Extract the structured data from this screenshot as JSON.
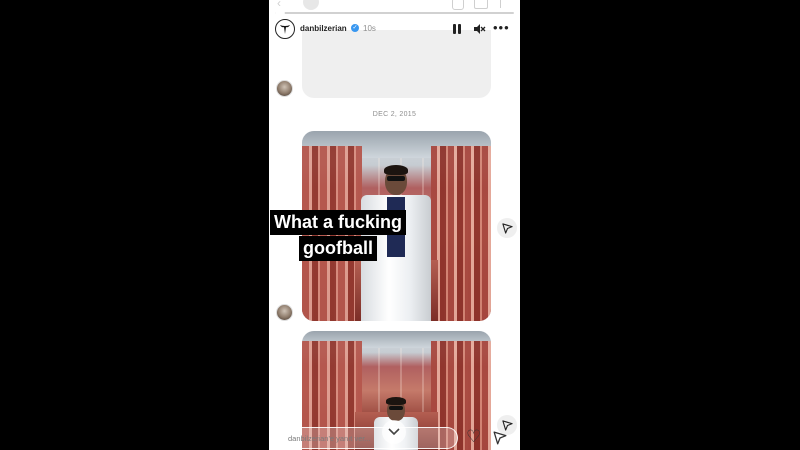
{
  "story": {
    "username": "danbilzerian",
    "time_ago": "10s",
    "progress_fraction": 0.04
  },
  "thread": {
    "date_separator": "DEC 2, 2015"
  },
  "caption": {
    "line1": "What a fucking",
    "line2": "goofball"
  },
  "reply": {
    "placeholder": "danbilzerian'e yanıt ver..."
  },
  "icons": {
    "verified": "verified-badge-icon",
    "pause": "pause-icon",
    "mute": "mute-icon",
    "more": "more-icon",
    "share": "send-icon",
    "heart": "heart-icon",
    "chevron": "chevron-down-icon"
  },
  "colors": {
    "verified": "#3897f0",
    "caption_bg": "#000000",
    "caption_text": "#ffffff"
  }
}
